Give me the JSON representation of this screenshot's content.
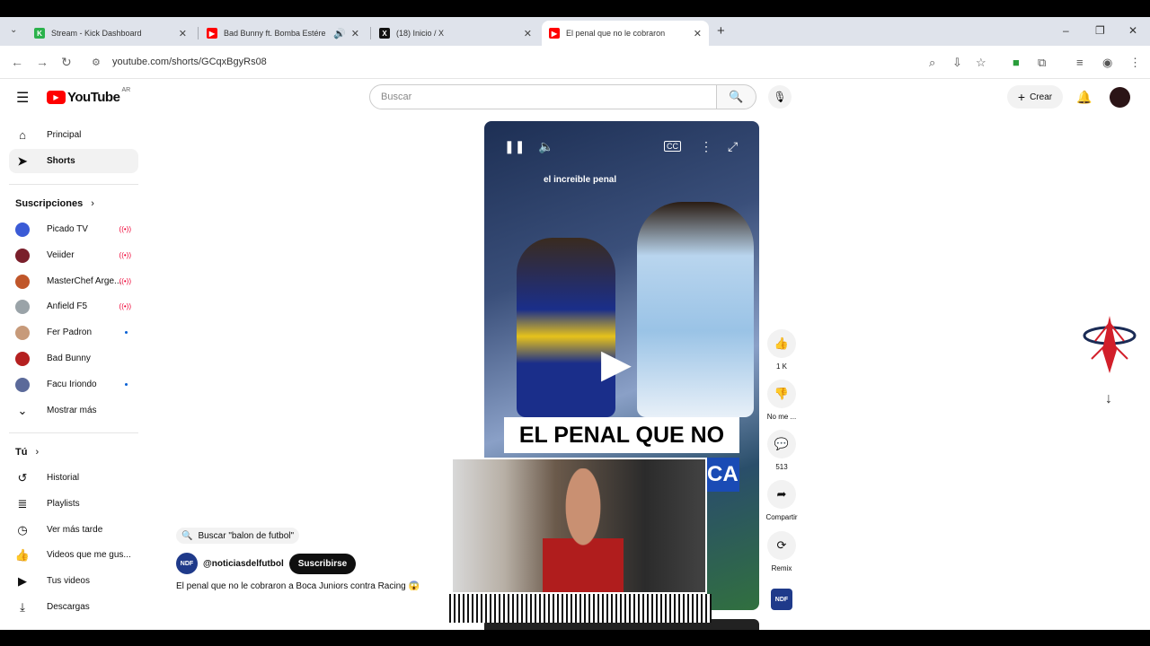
{
  "browser": {
    "tabs": [
      {
        "title": "Stream - Kick Dashboard",
        "icon": "kick-icon"
      },
      {
        "title": "Bad Bunny ft. Bomba Estére",
        "icon": "youtube-icon"
      },
      {
        "title": "(18) Inicio / X",
        "icon": "x-icon"
      },
      {
        "title": "El penal que no le cobraron",
        "icon": "youtube-icon"
      }
    ],
    "new_tab": "+",
    "url": "youtube.com/shorts/GCqxBgyRs08"
  },
  "youtube": {
    "logo_text": "YouTube",
    "logo_region": "AR",
    "search_placeholder": "Buscar",
    "create_label": "Crear"
  },
  "sidebar": {
    "main": [
      {
        "label": "Principal",
        "icon": "home-icon"
      },
      {
        "label": "Shorts",
        "icon": "shorts-icon"
      }
    ],
    "subs_heading": "Suscripciones",
    "subs": [
      {
        "label": "Picado TV",
        "color": "#3b5bd6",
        "status": "live"
      },
      {
        "label": "Veiider",
        "color": "#7a1f2b",
        "status": "live"
      },
      {
        "label": "MasterChef Arge...",
        "color": "#c0562a",
        "status": "live"
      },
      {
        "label": "Anfield F5",
        "color": "#9aa3a8",
        "status": "live"
      },
      {
        "label": "Fer Padron",
        "color": "#c79a7a",
        "status": "dot"
      },
      {
        "label": "Bad Bunny",
        "color": "#b52020",
        "status": ""
      },
      {
        "label": "Facu Iriondo",
        "color": "#5b6a9a",
        "status": "dot"
      }
    ],
    "show_more": "Mostrar más",
    "you_heading": "Tú",
    "you": [
      {
        "label": "Historial",
        "icon": "history-icon"
      },
      {
        "label": "Playlists",
        "icon": "playlists-icon"
      },
      {
        "label": "Ver más tarde",
        "icon": "clock-icon"
      },
      {
        "label": "Videos que me gus...",
        "icon": "like-icon"
      },
      {
        "label": "Tus videos",
        "icon": "video-icon"
      },
      {
        "label": "Descargas",
        "icon": "download-icon"
      }
    ]
  },
  "short": {
    "caption_small": "el increible penal",
    "caption_big": "EL PENAL QUE NO",
    "caption_blue": "CA",
    "search_chip": "Buscar \"balon de futbol\"",
    "channel_handle": "@noticiasdelfutbol",
    "channel_avatar_text": "NDF",
    "subscribe_label": "Suscribirse",
    "title": "El penal que no le cobraron a Boca Juniors contra Racing 😱"
  },
  "actions": [
    {
      "label": "1 K",
      "icon": "thumbs-up-icon"
    },
    {
      "label": "No me ...",
      "icon": "thumbs-down-icon"
    },
    {
      "label": "513",
      "icon": "comment-icon"
    },
    {
      "label": "Compartir",
      "icon": "share-icon"
    },
    {
      "label": "Remix",
      "icon": "remix-icon"
    }
  ]
}
